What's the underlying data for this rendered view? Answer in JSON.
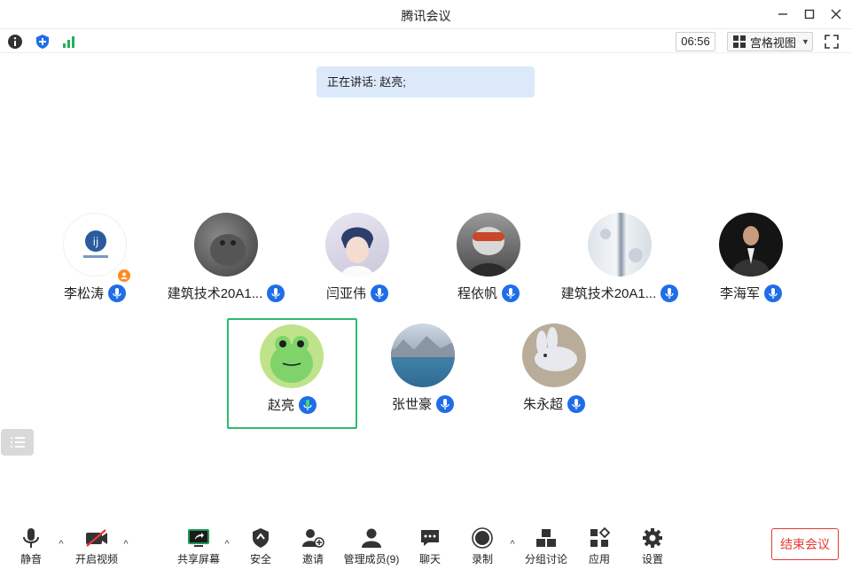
{
  "window": {
    "title": "腾讯会议"
  },
  "infobar": {
    "timer": "06:56",
    "view_label": "宫格视图"
  },
  "speaking": {
    "text": "正在讲话: 赵亮;"
  },
  "participants": [
    {
      "name": "李松涛",
      "host": true
    },
    {
      "name": "建筑技术20A1..."
    },
    {
      "name": "闫亚伟"
    },
    {
      "name": "程依帆"
    },
    {
      "name": "建筑技术20A1..."
    },
    {
      "name": "李海军"
    },
    {
      "name": "赵亮",
      "speaking": true
    },
    {
      "name": "张世豪"
    },
    {
      "name": "朱永超"
    }
  ],
  "toolbar": {
    "mute": "静音",
    "video": "开启视频",
    "share": "共享屏幕",
    "security": "安全",
    "invite": "邀请",
    "members": "管理成员(9)",
    "chat": "聊天",
    "record": "录制",
    "breakout": "分组讨论",
    "apps": "应用",
    "settings": "设置",
    "end": "结束会议"
  },
  "colors": {
    "accent": "#1f6ee8",
    "speaking_border": "#2fbb6c",
    "end": "#e53935",
    "banner": "#dce9fb"
  }
}
